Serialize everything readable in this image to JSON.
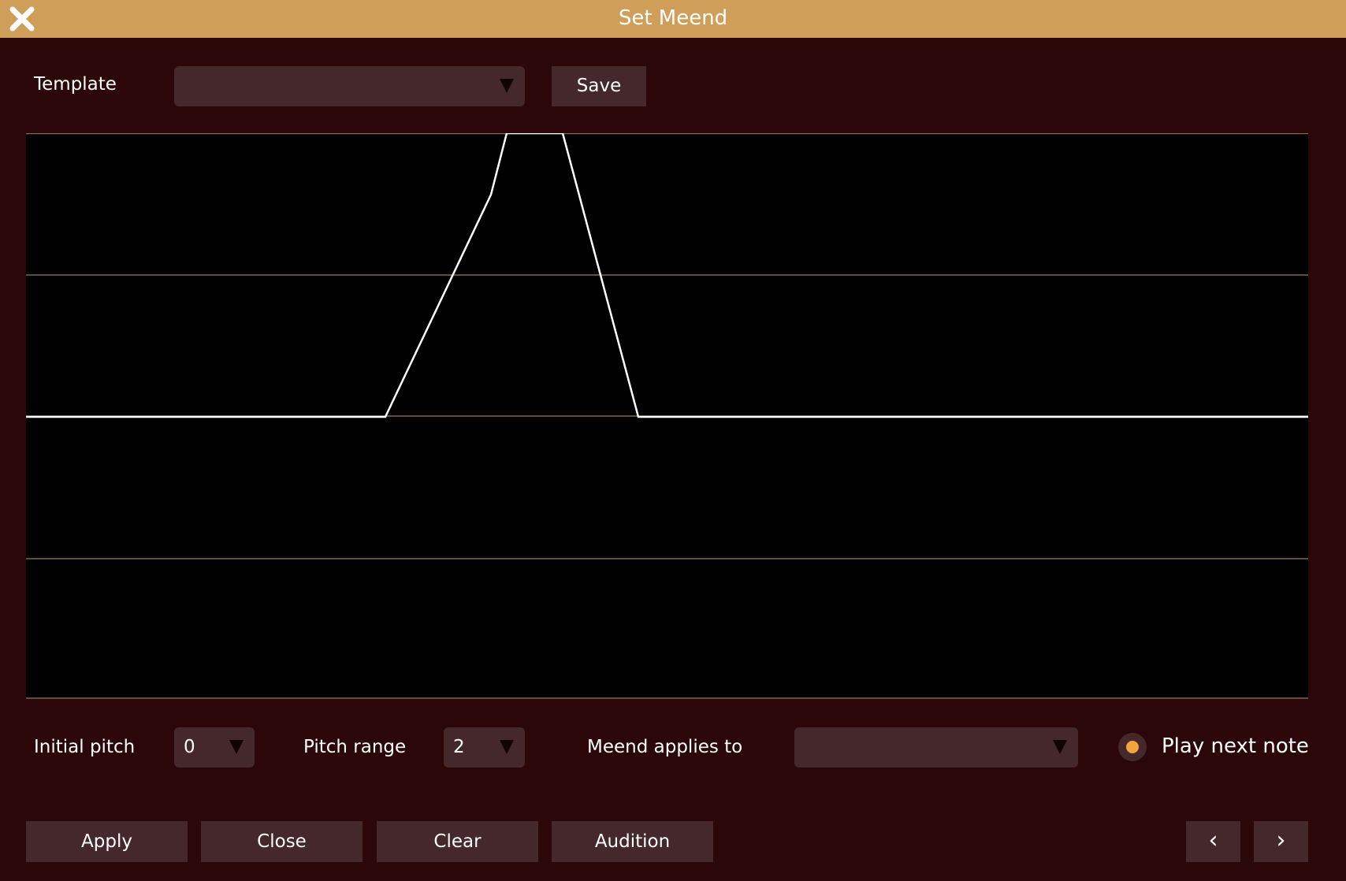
{
  "window": {
    "title": "Set Meend"
  },
  "template": {
    "label": "Template",
    "value": "",
    "save_label": "Save"
  },
  "graph": {
    "curve_label": "meend curve"
  },
  "controls": {
    "initial_pitch_label": "Initial pitch",
    "initial_pitch_value": "0",
    "pitch_range_label": "Pitch range",
    "pitch_range_value": "2",
    "meend_applies_label": "Meend applies to",
    "meend_applies_value": "",
    "play_next_label": "Play next note",
    "play_next_selected": true
  },
  "buttons": {
    "apply": "Apply",
    "close": "Close",
    "clear": "Clear",
    "audition": "Audition",
    "prev": "‹",
    "next": "›"
  },
  "colors": {
    "titlebar": "#cf9e58",
    "background": "#2c0709",
    "control": "#45282b",
    "gridline": "#7d6a4f",
    "curve": "#ffffff",
    "radio_dot": "#f3a53c"
  }
}
